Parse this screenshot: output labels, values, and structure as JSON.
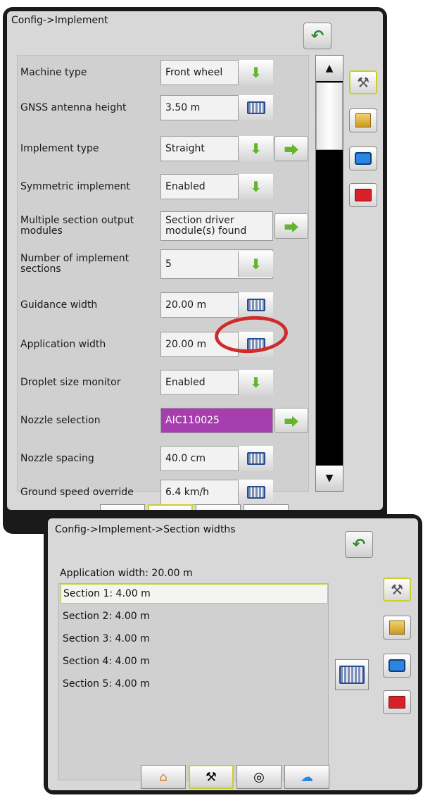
{
  "screen1": {
    "title": "Config->Implement",
    "rows": [
      {
        "label": "Machine type",
        "value": "Front wheel",
        "control": "dropdown"
      },
      {
        "label": "GNSS antenna height",
        "value": "3.50 m",
        "control": "keyboard"
      },
      {
        "label": "Implement type",
        "value": "Straight",
        "control": "dropdown",
        "next": true
      },
      {
        "label": "Symmetric implement",
        "value": "Enabled",
        "control": "dropdown"
      },
      {
        "label": "Multiple section output modules",
        "value": "Section driver module(s) found",
        "control": "none",
        "next": true
      },
      {
        "label": "Number of implement sections",
        "value": "5",
        "control": "dropdown"
      },
      {
        "label": "Guidance width",
        "value": "20.00 m",
        "control": "keyboard"
      },
      {
        "label": "Application width",
        "value": "20.00 m",
        "control": "keyboard"
      },
      {
        "label": "Droplet size monitor",
        "value": "Enabled",
        "control": "dropdown"
      },
      {
        "label": "Nozzle selection",
        "value": "AIC110025",
        "control": "none",
        "next": true,
        "highlight": "#a63eb0"
      },
      {
        "label": "Nozzle spacing",
        "value": "40.0 cm",
        "control": "keyboard"
      },
      {
        "label": "Ground speed override",
        "value": "6.4 km/h",
        "control": "keyboard"
      }
    ]
  },
  "screen2": {
    "title": "Config->Implement->Section widths",
    "application_width": "Application width: 20.00 m",
    "sections": [
      "Section 1: 4.00 m",
      "Section 2: 4.00 m",
      "Section 3: 4.00 m",
      "Section 4: 4.00 m",
      "Section 5: 4.00 m"
    ],
    "selected_index": 0
  },
  "icons": {
    "back": "back-arrow-icon",
    "dropdown": "green-down-arrow-icon",
    "next": "green-right-arrow-icon",
    "keyboard": "keyboard-icon",
    "side_tabs": [
      "tools-icon",
      "cabinet-icon",
      "monitor-icon",
      "toolbox-icon"
    ],
    "bottom_nav": [
      "home-icon",
      "tools-icon",
      "gauge-icon",
      "cloud-icon"
    ]
  },
  "colors": {
    "accent": "#c7d12a",
    "green_arrow": "#62b52c",
    "circle": "#d12a2a",
    "nozzle_highlight": "#a63eb0"
  }
}
